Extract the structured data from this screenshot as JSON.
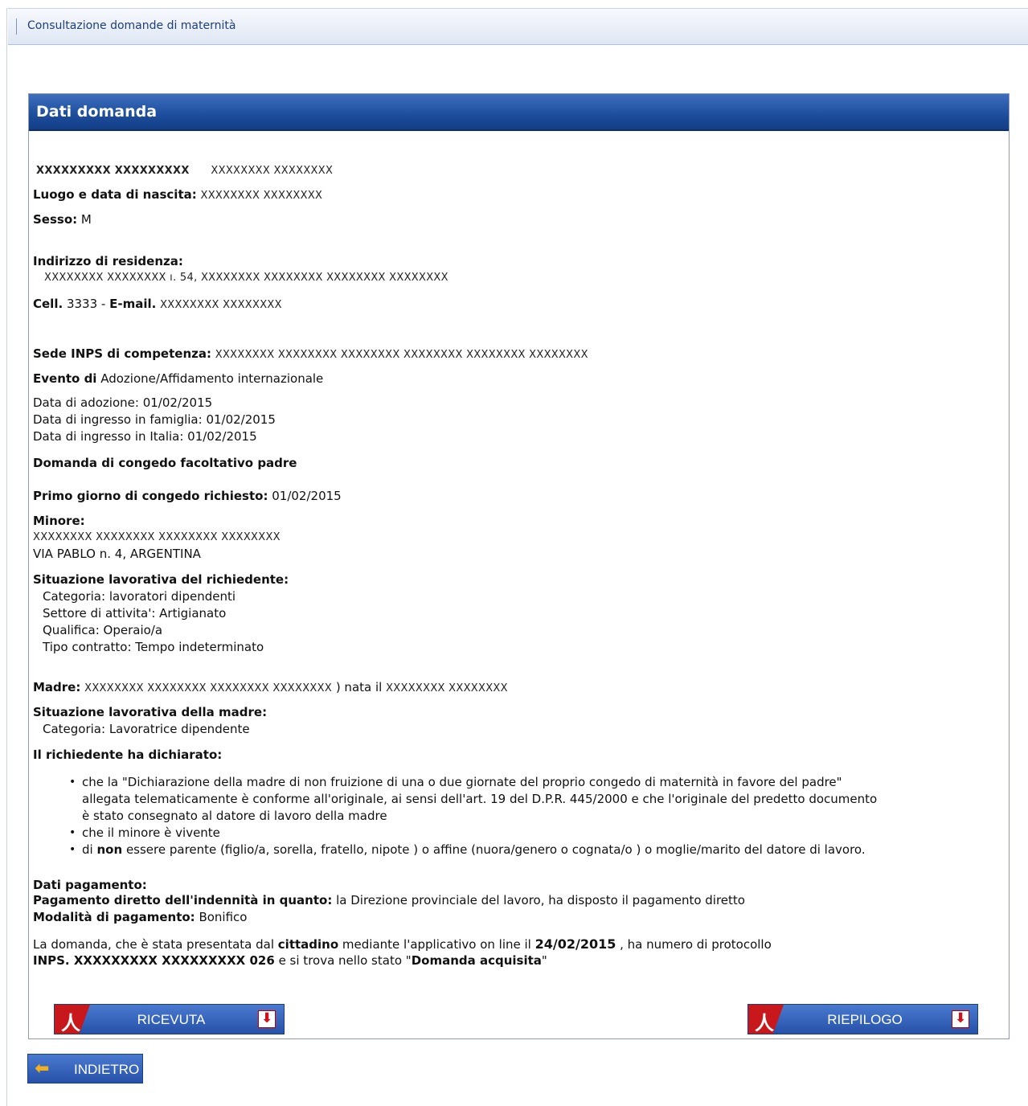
{
  "breadcrumb": "Consultazione domande di maternità",
  "panel_title": "Dati domanda",
  "applicant": {
    "name_masked": "XXXXXXXXX XXXXXXXXX",
    "code_masked": "XXXXXXXX XXXXXXXX",
    "birth_label": "Luogo e data di nascita:",
    "birth_value": "XXXXXXXX XXXXXXXX",
    "sex_label": "Sesso:",
    "sex_value": "M",
    "address_label": "Indirizzo di residenza:",
    "address_value": "XXXXXXXX XXXXXXXX ı. 54,   XXXXXXXX XXXXXXXX  XXXXXXXX XXXXXXXX",
    "cell_label": "Cell.",
    "cell_value": "3333 -",
    "email_label": "E-mail.",
    "email_value": "XXXXXXXX XXXXXXXX"
  },
  "inps_office_label": "Sede INPS di competenza:",
  "inps_office_value": "XXXXXXXX XXXXXXXX  XXXXXXXX XXXXXXXX XXXXXXXX XXXXXXXX",
  "event_label": "Evento di",
  "event_value": "Adozione/Affidamento internazionale",
  "dates": [
    "Data di adozione: 01/02/2015",
    "Data di ingresso in famiglia: 01/02/2015",
    "Data di ingresso in Italia: 01/02/2015"
  ],
  "request_type": "Domanda di congedo facoltativo padre",
  "first_day_label": "Primo giorno di congedo richiesto:",
  "first_day_value": "01/02/2015",
  "minor_label": "Minore:",
  "minor_name": "XXXXXXXX XXXXXXXX XXXXXXXX XXXXXXXX",
  "minor_address": "VIA PABLO n. 4,   ARGENTINA",
  "work_label": "Situazione lavorativa del richiedente:",
  "work_lines": [
    "Categoria: lavoratori dipendenti",
    "Settore di attivita': Artigianato",
    "Qualifica: Operaio/a",
    "Tipo contratto: Tempo indeterminato"
  ],
  "mother_label": "Madre:",
  "mother_value_a": "XXXXXXXX XXXXXXXX  XXXXXXXX XXXXXXXX",
  "mother_value_b": ") nata il",
  "mother_value_c": "XXXXXXXX XXXXXXXX",
  "mother_work_label": "Situazione lavorativa della madre:",
  "mother_work_line": "Categoria:   Lavoratrice dipendente",
  "declared_label": "Il richiedente ha dichiarato:",
  "declarations": {
    "d1_l1": "che la \"Dichiarazione della madre di non fruizione di una o due giornate del proprio congedo di maternità in favore del padre\"",
    "d1_l2": "allegata telematicamente è conforme all'originale, ai sensi dell'art. 19 del D.P.R. 445/2000 e che l'originale del predetto documento",
    "d1_l3": "è stato consegnato al datore di lavoro della madre",
    "d2": "che il minore è vivente",
    "d3_pre": "di",
    "d3_bold": "non",
    "d3_post": "essere parente (figlio/a, sorella, fratello, nipote ) o affine (nuora/genero o cognata/o ) o moglie/marito del datore di lavoro."
  },
  "payment": {
    "label": "Dati pagamento:",
    "direct_label": "Pagamento diretto dell'indennità in quanto:",
    "direct_value": "la Direzione provinciale del lavoro, ha disposto il pagamento diretto",
    "mode_label": "Modalità di pagamento:",
    "mode_value": "Bonifico"
  },
  "summary": {
    "t1": "La domanda, che è stata presentata dal",
    "t2": "cittadino",
    "t3": "mediante l'applicativo on line il",
    "t4": "24/02/2015",
    "t5": ", ha numero di protocollo",
    "t6": "INPS. XXXXXXXXX XXXXXXXXX  026",
    "t7": "e si trova nello stato \"",
    "t8": "Domanda acquisita",
    "t9": "\""
  },
  "buttons": {
    "receipt": "RICEVUTA",
    "summary": "RIEPILOGO",
    "back": "INDIETRO"
  },
  "colors": {
    "header_blue": "#1f4f9f",
    "pdf_red": "#c8181c"
  }
}
